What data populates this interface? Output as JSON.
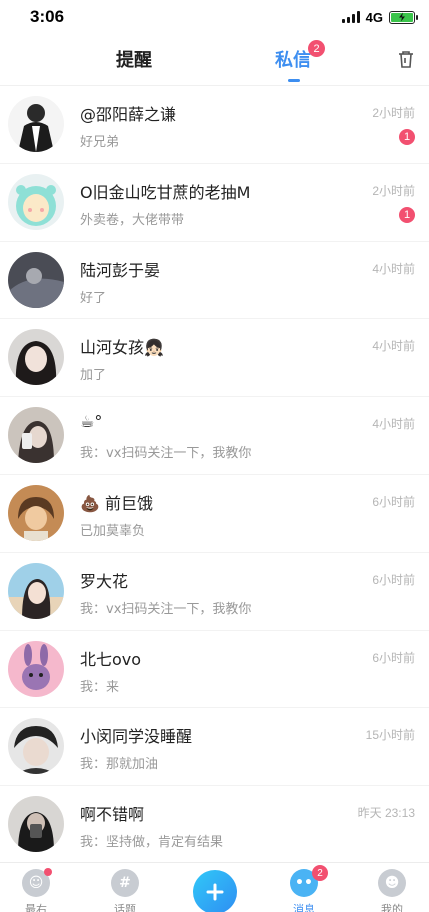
{
  "status_bar": {
    "time": "3:06",
    "network": "4G"
  },
  "tabs": {
    "reminder": "提醒",
    "direct_messages": "私信",
    "dm_badge": "2"
  },
  "messages": [
    {
      "name": "@邵阳薛之谦",
      "preview": "好兄弟",
      "time": "2小时前",
      "unread": "1"
    },
    {
      "name": "O旧金山吃甘蔗的老抽M",
      "preview": "外卖卷，大佬带带",
      "time": "2小时前",
      "unread": "1"
    },
    {
      "name": "陆河彭于晏",
      "preview": "好了",
      "time": "4小时前",
      "unread": ""
    },
    {
      "name": "山河女孩👧🏻",
      "preview": "加了",
      "time": "4小时前",
      "unread": ""
    },
    {
      "name": "☕︎°",
      "preview": "我：vx扫码关注一下，我教你",
      "time": "4小时前",
      "unread": ""
    },
    {
      "name": "💩 前巨饿",
      "preview": "已加莫辜负",
      "time": "6小时前",
      "unread": ""
    },
    {
      "name": "罗大花",
      "preview": "我：vx扫码关注一下，我教你",
      "time": "6小时前",
      "unread": ""
    },
    {
      "name": "北七ovo",
      "preview": "我：来",
      "time": "6小时前",
      "unread": ""
    },
    {
      "name": "小闵同学没睡醒",
      "preview": "我：那就加油",
      "time": "15小时前",
      "unread": ""
    },
    {
      "name": "啊不错啊",
      "preview": "我：坚持做，肯定有结果",
      "time": "昨天 23:13",
      "unread": ""
    }
  ],
  "tabbar": {
    "latest": "最右",
    "topics": "话题",
    "messages": "消息",
    "messages_badge": "2",
    "mine": "我的"
  },
  "colors": {
    "accent": "#3d8ef0",
    "badge": "#f25070"
  }
}
